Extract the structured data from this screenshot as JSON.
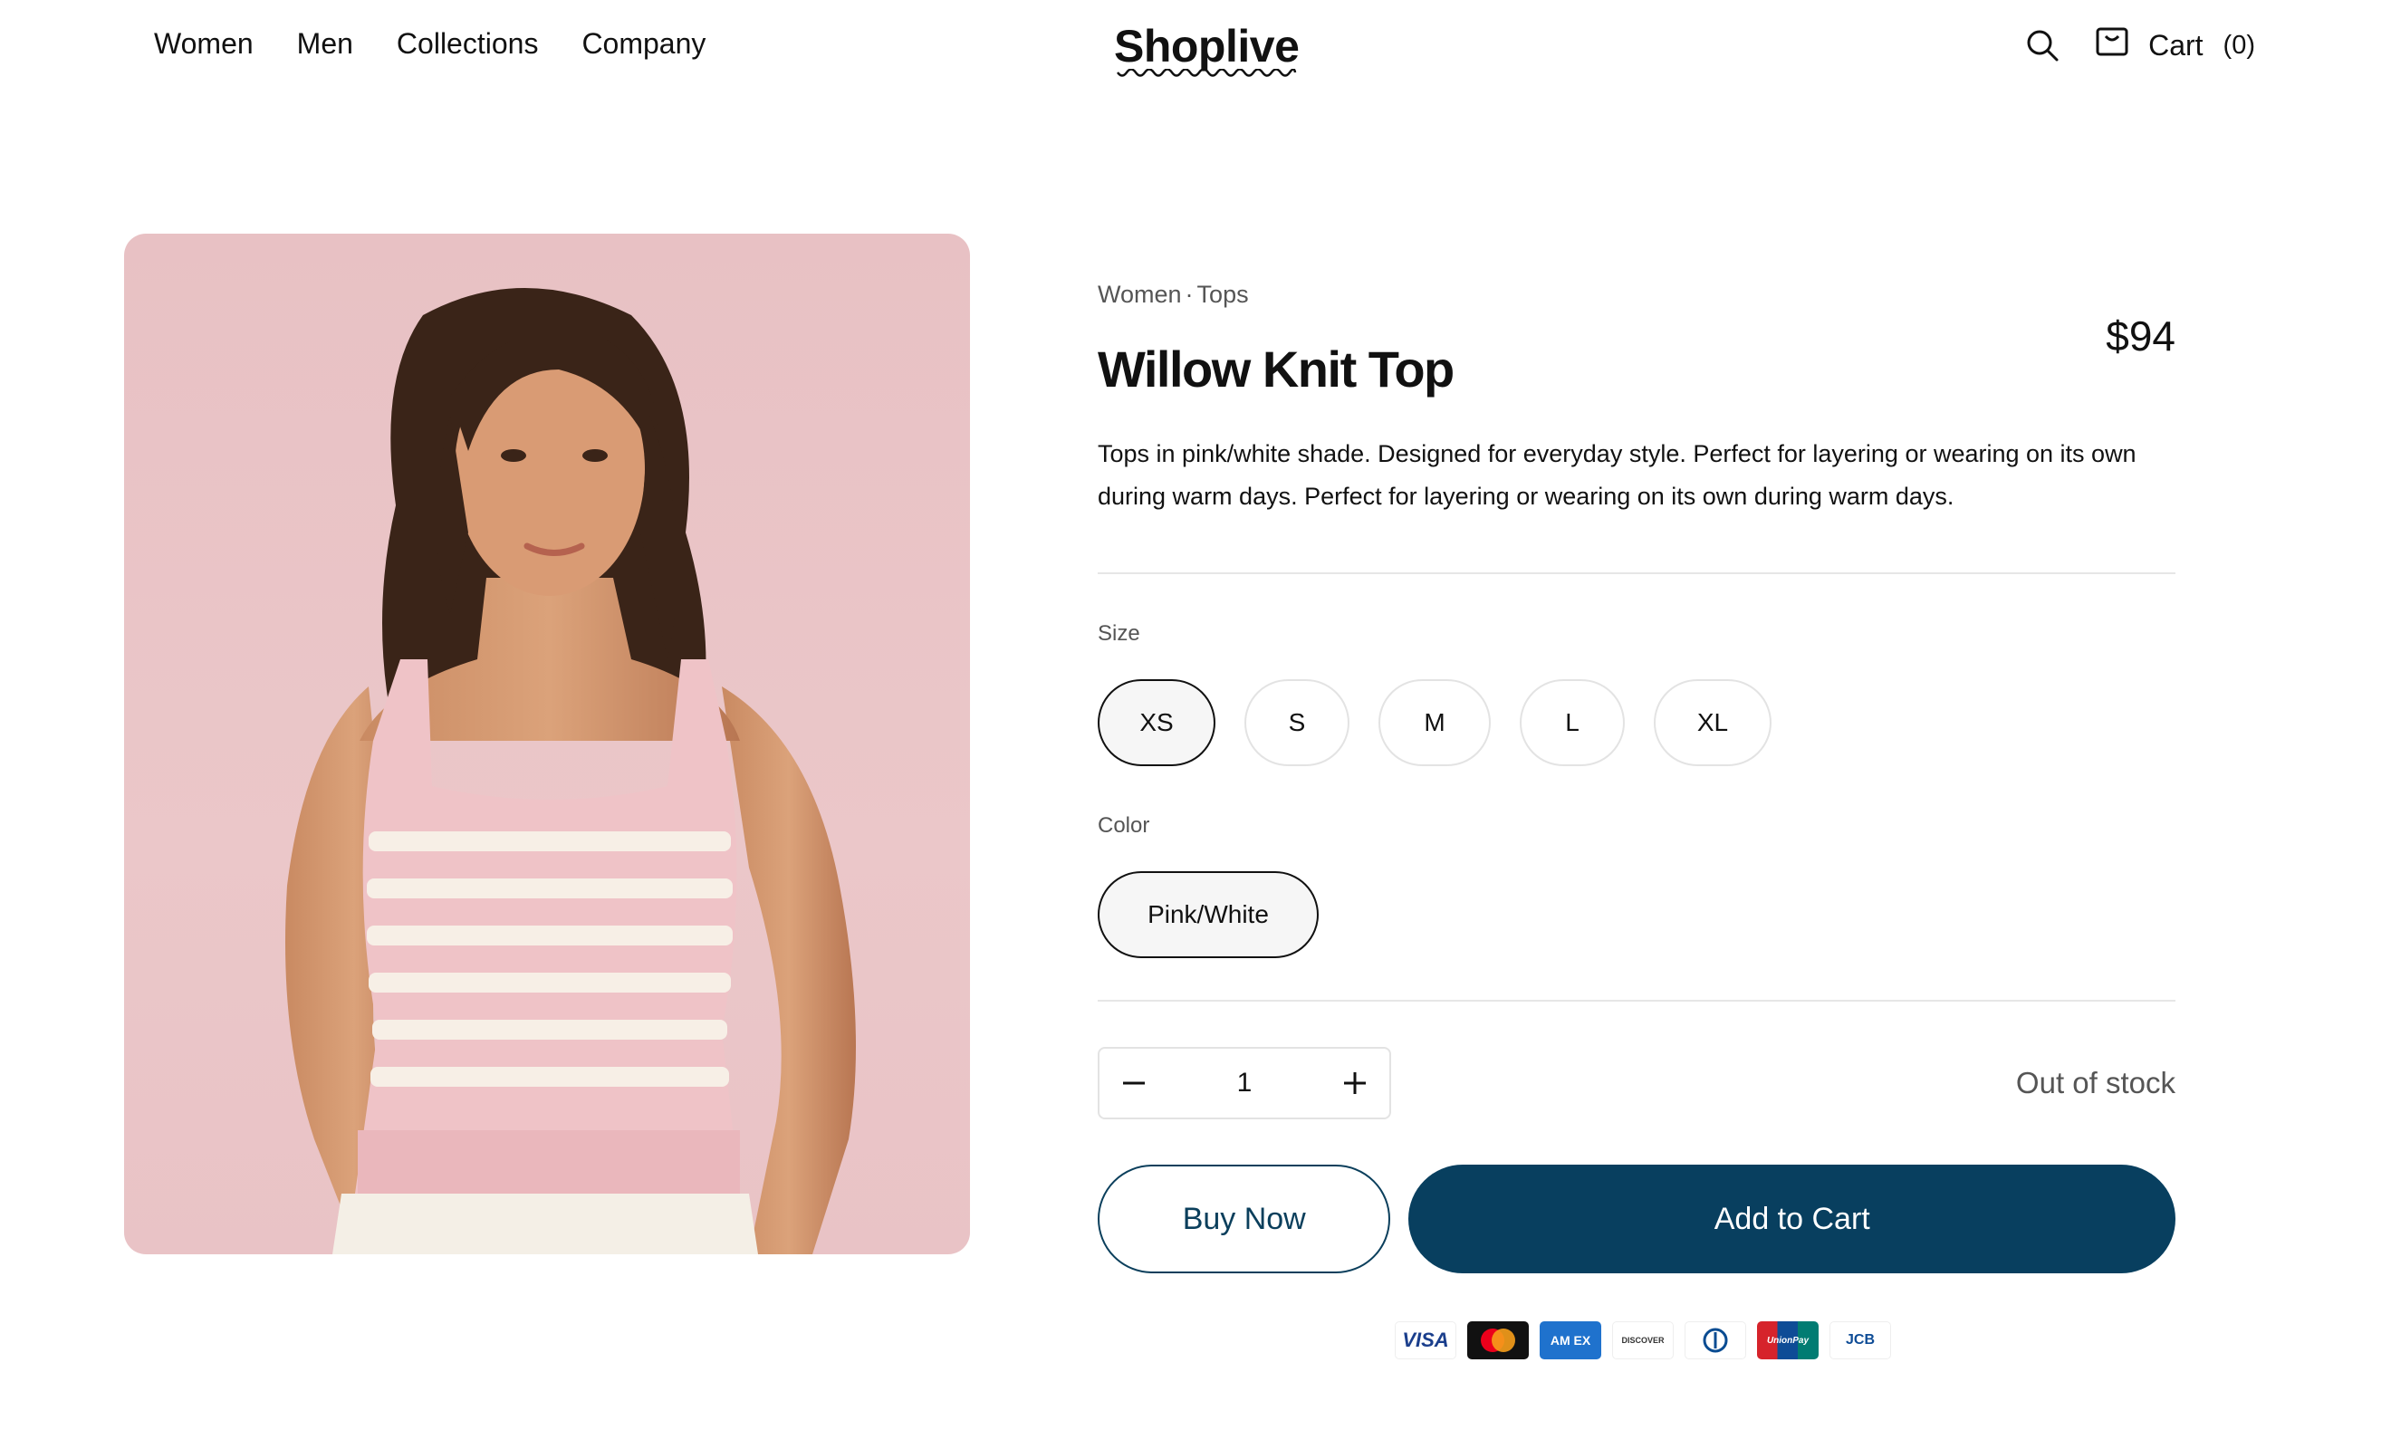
{
  "header": {
    "nav": [
      "Women",
      "Men",
      "Collections",
      "Company"
    ],
    "logo": "Shoplive",
    "cart_label": "Cart",
    "cart_count": "(0)"
  },
  "product": {
    "breadcrumb": {
      "category": "Women",
      "separator": "·",
      "subcategory": "Tops"
    },
    "title": "Willow Knit Top",
    "price": "$94",
    "description": "Tops in pink/white shade. Designed for everyday style. Perfect for layering or wearing on its own during warm days. Perfect for layering or wearing on its own during warm days.",
    "size_label": "Size",
    "sizes": [
      "XS",
      "S",
      "M",
      "L",
      "XL"
    ],
    "selected_size": "XS",
    "color_label": "Color",
    "colors": [
      "Pink/White"
    ],
    "selected_color": "Pink/White",
    "quantity": "1",
    "stock_status": "Out of stock",
    "buy_now_label": "Buy Now",
    "add_to_cart_label": "Add to Cart"
  },
  "payments": {
    "visa": "VISA",
    "amex": "AM EX",
    "discover": "DISCOVER",
    "unionpay": "UnionPay",
    "jcb": "JCB"
  },
  "colors": {
    "primary": "#083f5f",
    "text": "#111111",
    "muted": "#555555",
    "image_bg": "#e8c1c4"
  }
}
